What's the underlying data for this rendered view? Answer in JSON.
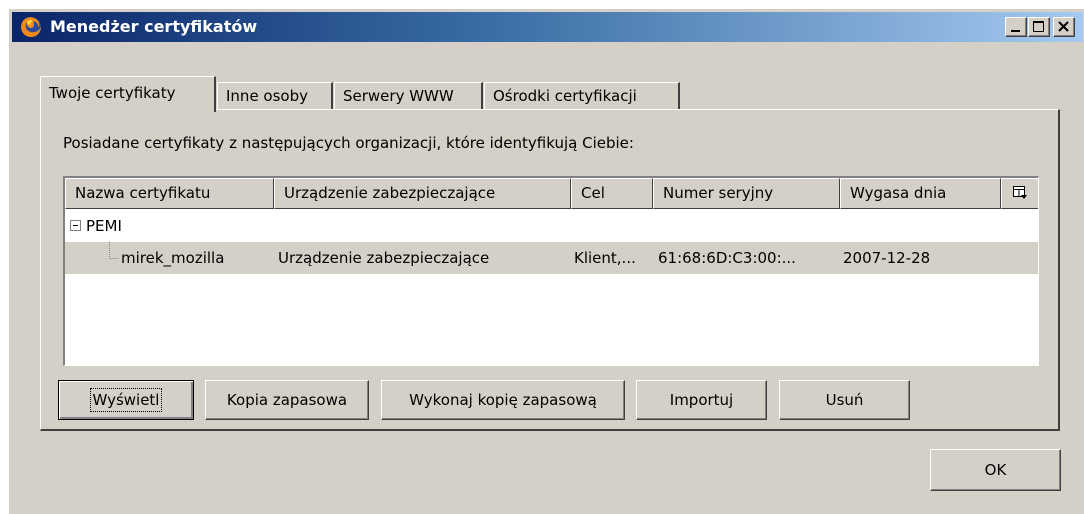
{
  "window": {
    "title": "Menedżer certyfikatów",
    "controls": {
      "minimize": "minimize",
      "maximize": "maximize",
      "close": "close"
    }
  },
  "tabs": [
    {
      "label": "Twoje certyfikaty",
      "active": true
    },
    {
      "label": "Inne osoby",
      "active": false
    },
    {
      "label": "Serwery WWW",
      "active": false
    },
    {
      "label": "Ośrodki certyfikacji",
      "active": false
    }
  ],
  "panel": {
    "description": "Posiadane certyfikaty z następujących organizacji, które identyfikują Ciebie:"
  },
  "table": {
    "columns": [
      "Nazwa certyfikatu",
      "Urządzenie zabezpieczające",
      "Cel",
      "Numer seryjny",
      "Wygasa dnia"
    ],
    "column_picker_icon": "column-picker-icon",
    "groups": [
      {
        "name": "PEMI",
        "expanded": true,
        "rows": [
          {
            "name": "mirek_mozilla",
            "device": "Urządzenie zabezpieczające",
            "purpose": "Klient,...",
            "serial": "61:68:6D:C3:00:...",
            "expires": "2007-12-28",
            "selected": true
          }
        ]
      }
    ]
  },
  "buttons": {
    "view": "Wyświetl",
    "backup": "Kopia zapasowa",
    "backup_all": "Wykonaj kopię zapasową",
    "import": "Importuj",
    "delete": "Usuń",
    "ok": "OK"
  },
  "colors": {
    "face": "#d4d0c8",
    "title_start": "#0a246a",
    "title_end": "#a6caf0"
  }
}
